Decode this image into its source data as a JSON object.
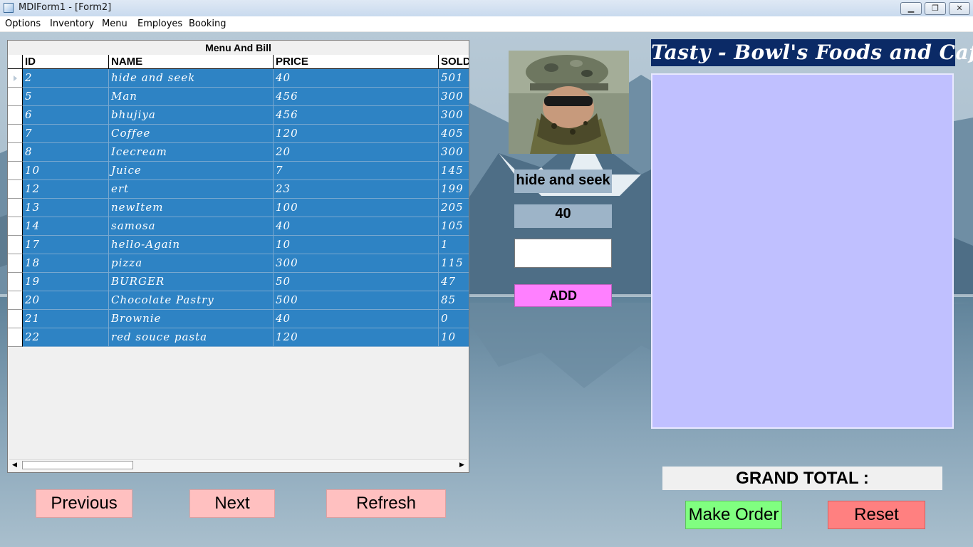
{
  "window": {
    "title": "MDIForm1 - [Form2]",
    "min_glyph": "▁",
    "restore_glyph": "❐",
    "close_glyph": "✕"
  },
  "menu": [
    "Options",
    "Inventory",
    "Menu",
    "Employes",
    "Booking"
  ],
  "grid": {
    "caption": "Menu And Bill",
    "columns": [
      "ID",
      "NAME",
      "PRICE",
      "SOLD"
    ],
    "rows": [
      [
        "2",
        "hide and seek",
        "40",
        "501"
      ],
      [
        "5",
        "Man",
        "456",
        "300"
      ],
      [
        "6",
        "bhujiya",
        "456",
        "300"
      ],
      [
        "7",
        "Coffee",
        "120",
        "405"
      ],
      [
        "8",
        "Icecream",
        "20",
        "300"
      ],
      [
        "10",
        "Juice",
        "7",
        "145"
      ],
      [
        "12",
        "ert",
        "23",
        "199"
      ],
      [
        "13",
        "newItem",
        "100",
        "205"
      ],
      [
        "14",
        "samosa",
        "40",
        "105"
      ],
      [
        "17",
        "hello-Again",
        "10",
        "1"
      ],
      [
        "18",
        "pizza",
        " 300",
        "115"
      ],
      [
        "19",
        "BURGER",
        "50",
        "47"
      ],
      [
        "20",
        "Chocolate Pastry",
        "500",
        "85"
      ],
      [
        "21",
        "Brownie",
        "40",
        "0"
      ],
      [
        "22",
        "red souce pasta",
        "120",
        "10"
      ]
    ]
  },
  "nav": {
    "previous": "Previous",
    "next": "Next",
    "refresh": "Refresh"
  },
  "selected": {
    "name": "hide and seek",
    "price": "40",
    "quantity": ""
  },
  "add_label": "ADD",
  "brand": "Tasty - Bowl's Foods and Cafe",
  "grand_total_label": "GRAND TOTAL :",
  "make_order": "Make Order",
  "reset": "Reset"
}
